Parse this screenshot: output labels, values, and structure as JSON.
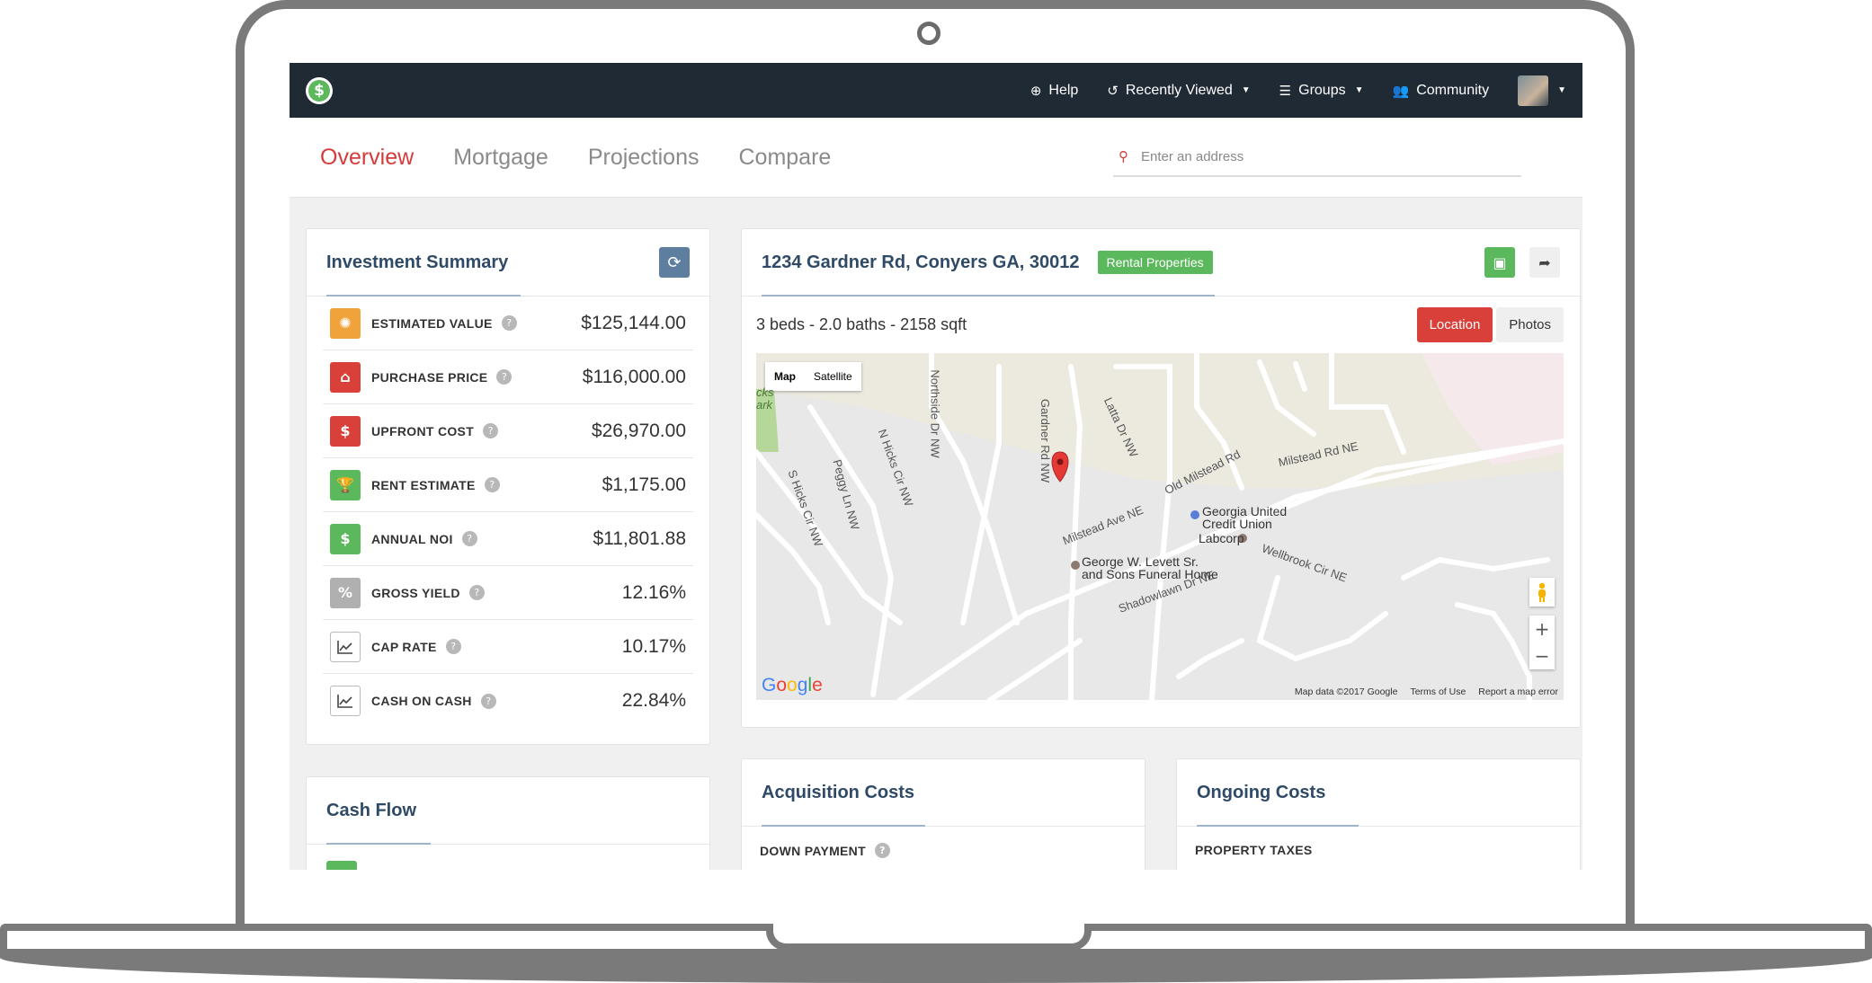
{
  "navbar": {
    "logo_symbol": "$",
    "items": [
      {
        "label": "Help",
        "icon": "life-ring-icon"
      },
      {
        "label": "Recently Viewed",
        "icon": "history-icon"
      },
      {
        "label": "Groups",
        "icon": "list-icon"
      },
      {
        "label": "Community",
        "icon": "users-icon"
      }
    ]
  },
  "tabs": [
    {
      "label": "Overview",
      "active": true
    },
    {
      "label": "Mortgage",
      "active": false
    },
    {
      "label": "Projections",
      "active": false
    },
    {
      "label": "Compare",
      "active": false
    }
  ],
  "search": {
    "placeholder": "Enter an address"
  },
  "investment_summary": {
    "title": "Investment Summary",
    "rows": [
      {
        "label": "ESTIMATED VALUE",
        "value": "$125,144.00",
        "color": "#f0a33a",
        "icon": "sun-icon"
      },
      {
        "label": "PURCHASE PRICE",
        "value": "$116,000.00",
        "color": "#d9403a",
        "icon": "home-icon"
      },
      {
        "label": "UPFRONT COST",
        "value": "$26,970.00",
        "color": "#d9403a",
        "icon": "dollar-icon"
      },
      {
        "label": "RENT ESTIMATE",
        "value": "$1,175.00",
        "color": "#5cb85c",
        "icon": "trophy-icon"
      },
      {
        "label": "ANNUAL NOI",
        "value": "$11,801.88",
        "color": "#5cb85c",
        "icon": "dollar-icon"
      },
      {
        "label": "GROSS YIELD",
        "value": "12.16%",
        "color": "#b0b0b0",
        "icon": "percent-icon"
      },
      {
        "label": "CAP RATE",
        "value": "10.17%",
        "color": "#ffffff",
        "icon": "line-chart-icon"
      },
      {
        "label": "CASH ON CASH",
        "value": "22.84%",
        "color": "#ffffff",
        "icon": "line-chart-icon"
      }
    ]
  },
  "property": {
    "address": "1234 Gardner Rd, Conyers GA, 30012",
    "badge": "Rental Properties",
    "details": "3 beds - 2.0 baths - 2158 sqft",
    "location_button": "Location",
    "photos_button": "Photos"
  },
  "map": {
    "type_map": "Map",
    "type_satellite": "Satellite",
    "labels": [
      "N Hicks Cir NW",
      "Peggy Ln NW",
      "S Hicks Cir NW",
      "Northside Dr NW",
      "Gardner Rd NW",
      "Latta Dr NW",
      "Old Milstead Rd",
      "Milstead Rd NE",
      "Milstead Ave NE",
      "Wellbrook Cir NE",
      "Shadowlawn Dr NE",
      "cks",
      "ark"
    ],
    "pois": [
      "Georgia United",
      "Credit Union",
      "Labcorp",
      "George W. Levett Sr.",
      "and Sons Funeral Home"
    ],
    "attribution": [
      "Map data ©2017 Google",
      "Terms of Use",
      "Report a map error"
    ],
    "brand": "Google"
  },
  "cash_flow": {
    "title": "Cash Flow"
  },
  "acquisition": {
    "title": "Acquisition Costs",
    "first_row": "DOWN PAYMENT"
  },
  "ongoing": {
    "title": "Ongoing Costs",
    "first_row": "PROPERTY TAXES"
  }
}
